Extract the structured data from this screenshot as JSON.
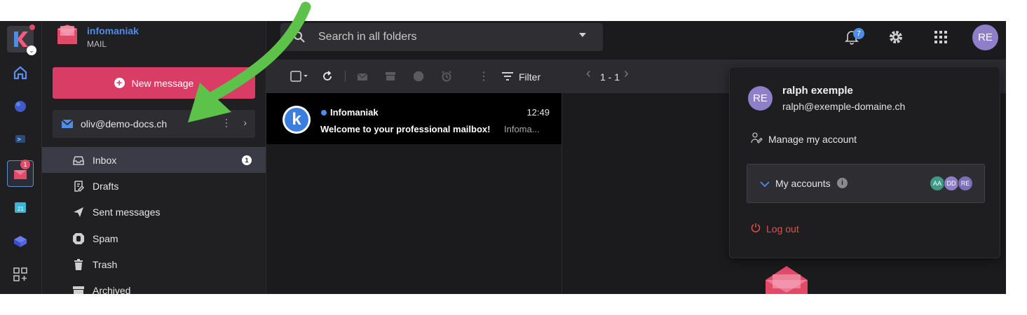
{
  "app": {
    "brand": "infomaniak",
    "product": "MAIL"
  },
  "rail": {
    "items": [
      {
        "name": "ksuite-menu",
        "icon": "ksuite-logo-icon"
      },
      {
        "name": "home",
        "icon": "home-icon"
      },
      {
        "name": "planet",
        "icon": "planet-icon"
      },
      {
        "name": "chat",
        "icon": "chat-icon"
      },
      {
        "name": "mail",
        "icon": "mail-icon",
        "badge": "1"
      },
      {
        "name": "calendar",
        "icon": "calendar-icon"
      },
      {
        "name": "drive",
        "icon": "drive-icon"
      },
      {
        "name": "apps",
        "icon": "add-apps-icon"
      }
    ]
  },
  "sidebar": {
    "new_message": "New message",
    "account_email": "oliv@demo-docs.ch",
    "folders": [
      {
        "label": "Inbox",
        "count": "1",
        "icon": "inbox-icon"
      },
      {
        "label": "Drafts",
        "icon": "drafts-icon"
      },
      {
        "label": "Sent messages",
        "icon": "send-icon"
      },
      {
        "label": "Spam",
        "icon": "spam-hand-icon"
      },
      {
        "label": "Trash",
        "icon": "trash-icon"
      },
      {
        "label": "Archived",
        "icon": "archive-icon"
      }
    ]
  },
  "topbar": {
    "search_placeholder": "Search in all folders",
    "notifications_count": "7",
    "avatar_initials": "RE"
  },
  "toolbar": {
    "filter": "Filter",
    "pager": "1 - 1"
  },
  "messages": [
    {
      "sender": "Infomaniak",
      "time": "12:49",
      "subject": "Welcome to your professional mailbox!",
      "preview": "Infoma..."
    }
  ],
  "account_panel": {
    "initials": "RE",
    "name": "ralph exemple",
    "email": "ralph@exemple-domaine.ch",
    "manage": "Manage my account",
    "my_accounts": "My accounts",
    "info": "i",
    "accounts": [
      "AA",
      "DD",
      "RE"
    ],
    "logout": "Log out"
  },
  "colors": {
    "accent_pink": "#d93d66",
    "accent_blue": "#4d8ce8",
    "annotation_green": "#5cc24a",
    "logout_red": "#e0524a"
  }
}
